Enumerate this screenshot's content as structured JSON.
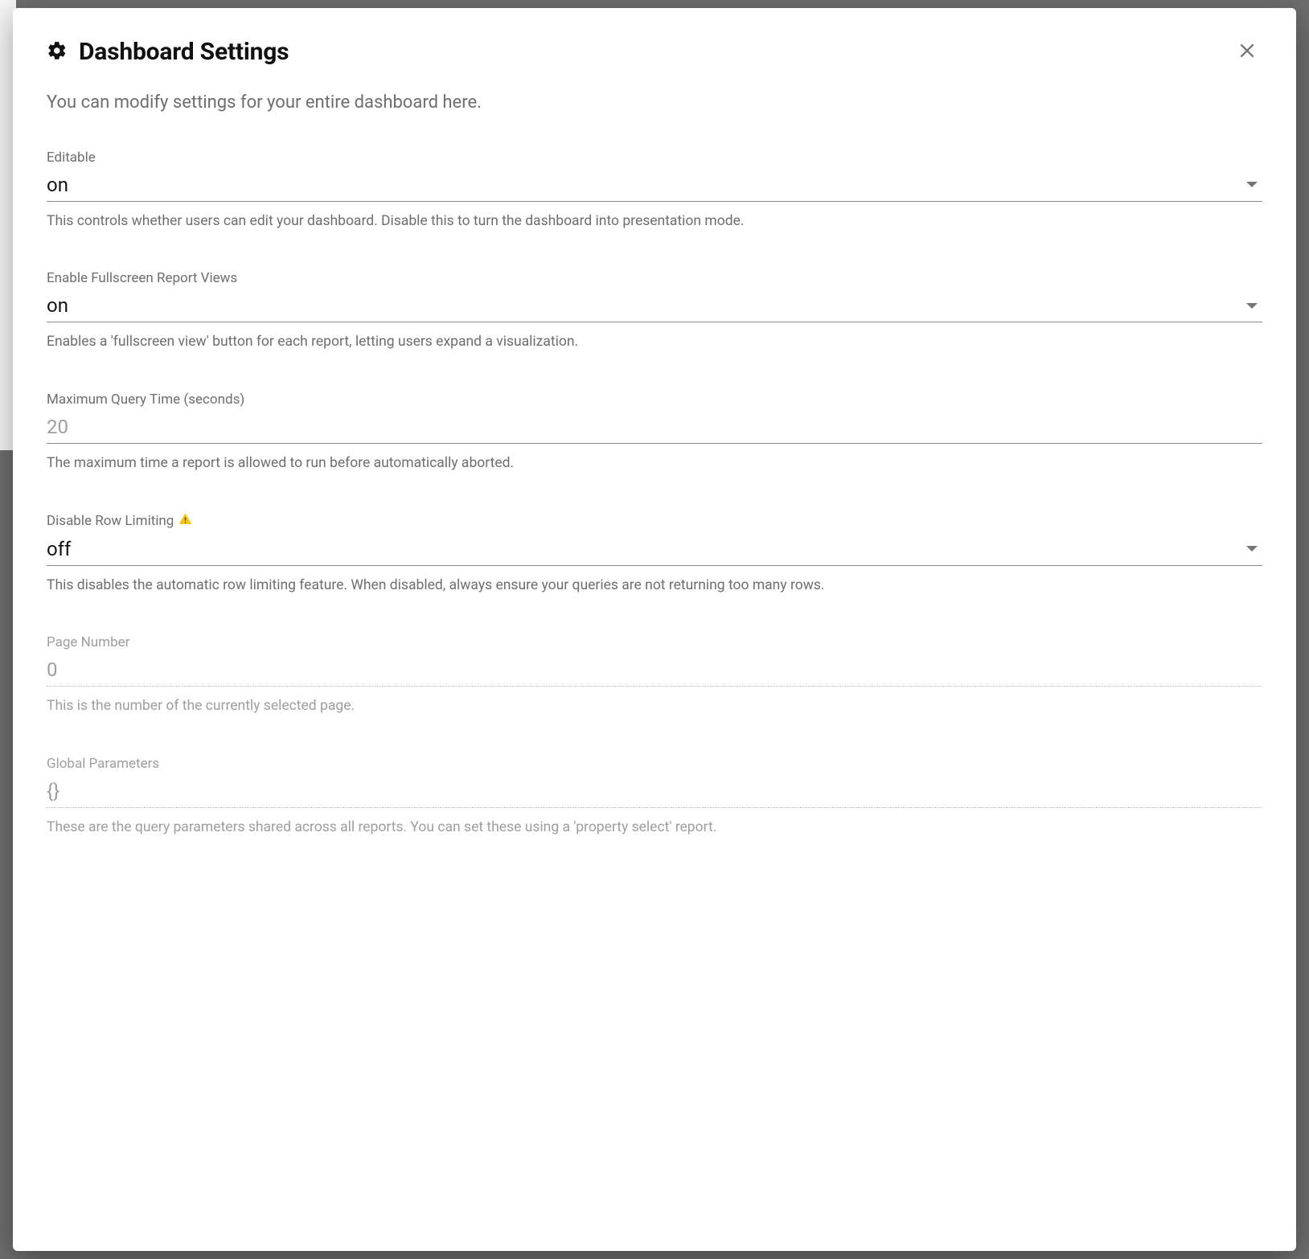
{
  "dialog": {
    "title": "Dashboard Settings",
    "subtitle": "You can modify settings for your entire dashboard here.",
    "icons": {
      "title_icon": "gear-icon",
      "close": "close-icon",
      "warning": "warning-icon"
    }
  },
  "fields": {
    "editable": {
      "label": "Editable",
      "value": "on",
      "help": "This controls whether users can edit your dashboard. Disable this to turn the dashboard into presentation mode."
    },
    "fullscreen": {
      "label": "Enable Fullscreen Report Views",
      "value": "on",
      "help": "Enables a 'fullscreen view' button for each report, letting users expand a visualization."
    },
    "max_query_time": {
      "label": "Maximum Query Time (seconds)",
      "placeholder": "20",
      "value": "",
      "help": "The maximum time a report is allowed to run before automatically aborted."
    },
    "disable_row_limiting": {
      "label": "Disable Row Limiting",
      "has_warning": true,
      "value": "off",
      "help": "This disables the automatic row limiting feature. When disabled, always ensure your queries are not returning too many rows."
    },
    "page_number": {
      "label": "Page Number",
      "value": "0",
      "help": "This is the number of the currently selected page.",
      "disabled": true
    },
    "global_parameters": {
      "label": "Global Parameters",
      "value": "{}",
      "help": "These are the query parameters shared across all reports. You can set these using a 'property select' report.",
      "disabled": true
    }
  }
}
